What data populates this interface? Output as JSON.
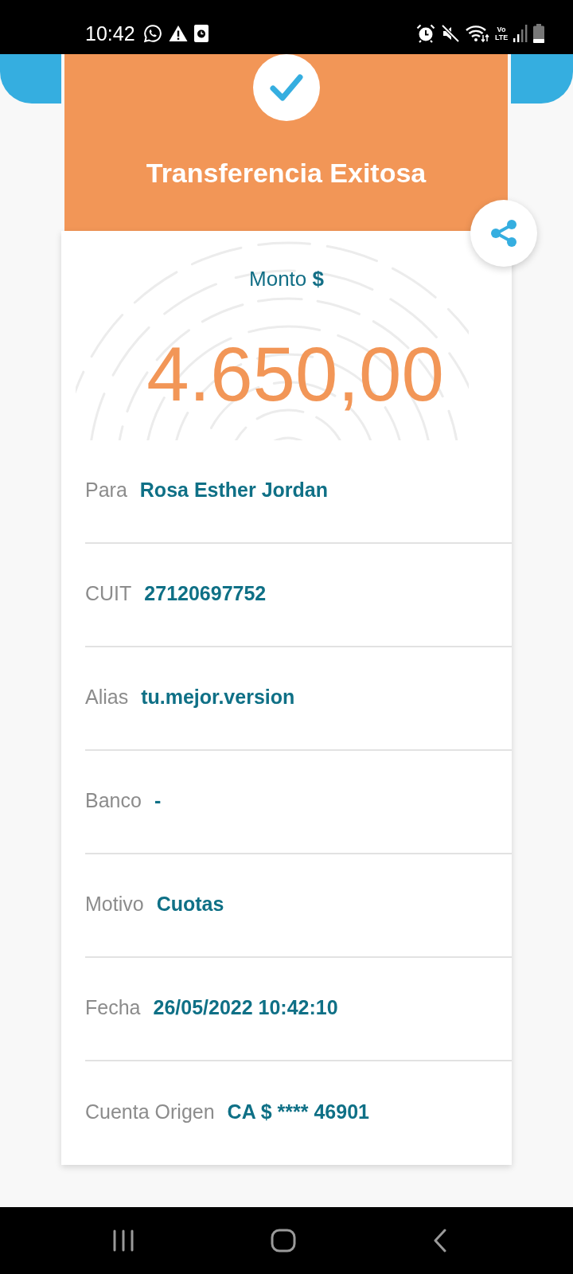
{
  "status_bar": {
    "time": "10:42",
    "network_label": "Vo LTE"
  },
  "header": {
    "title": "Transferencia Exitosa"
  },
  "amount": {
    "label": "Monto",
    "currency": "$",
    "value": "4.650,00"
  },
  "details": [
    {
      "label": "Para",
      "value": "Rosa Esther Jordan"
    },
    {
      "label": "CUIT",
      "value": "27120697752"
    },
    {
      "label": "Alias",
      "value": "tu.mejor.version"
    },
    {
      "label": "Banco",
      "value": "-"
    },
    {
      "label": "Motivo",
      "value": "Cuotas"
    },
    {
      "label": "Fecha",
      "value": "26/05/2022 10:42:10"
    },
    {
      "label": "Cuenta Origen",
      "value": "CA $ **** 46901"
    }
  ]
}
